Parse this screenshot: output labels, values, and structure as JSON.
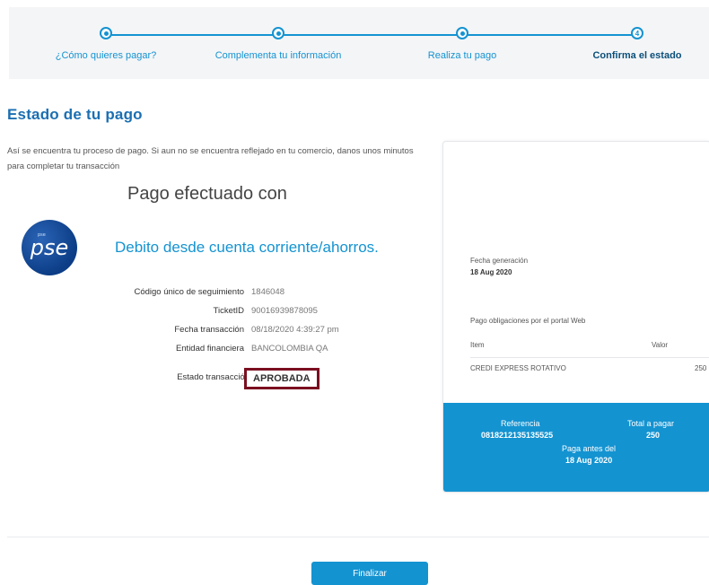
{
  "stepper": {
    "steps": [
      {
        "label": "¿Cómo quieres pagar?"
      },
      {
        "label": "Complementa tu información"
      },
      {
        "label": "Realiza tu pago"
      },
      {
        "label": "Confirma el estado",
        "number": "4"
      }
    ]
  },
  "page": {
    "title": "Estado de tu pago",
    "intro": "Así se encuentra tu proceso de pago. Si aun no se encuentra reflejado en tu comercio, danos unos minutos para completar tu transacción",
    "paid_with": "Pago efectuado con",
    "method": "Debito desde cuenta corriente/ahorros.",
    "logo_text": "pse",
    "logo_small": "pse"
  },
  "details": {
    "tracking_label": "Código único de seguimiento",
    "tracking_value": "1846048",
    "ticket_label": "TicketID",
    "ticket_value": "90016939878095",
    "date_label": "Fecha transacción",
    "date_value": "08/18/2020 4:39:27 pm",
    "bank_label": "Entidad financiera",
    "bank_value": "BANCOLOMBIA QA",
    "status_label": "Estado transacción",
    "status_value": "APROBADA"
  },
  "card": {
    "generation_label": "Fecha generación",
    "generation_date": "18 Aug 2020",
    "description": "Pago obligaciones por el portal Web",
    "col_item": "Item",
    "col_value": "Valor",
    "item_name": "CREDI EXPRESS ROTATIVO",
    "item_value": "250",
    "reference_label": "Referencia",
    "reference_value": "0818212135135525",
    "total_label": "Total a pagar",
    "total_value": "250",
    "pay_before_label": "Paga antes del",
    "pay_before_date": "18 Aug 2020"
  },
  "actions": {
    "finish_label": "Finalizar"
  },
  "colors": {
    "accent": "#1493d1",
    "title": "#1b6fb2",
    "status_border": "#7a0f20"
  }
}
